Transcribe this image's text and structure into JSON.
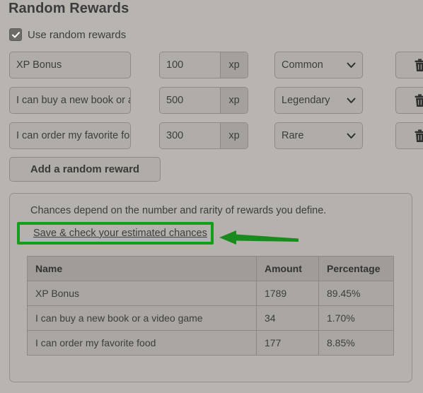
{
  "page_title": "Random Rewards",
  "use_random": {
    "label": "Use random rewards",
    "checked": true,
    "checkbox_icon": "check-icon"
  },
  "rewards": [
    {
      "name": "XP Bonus",
      "amount": "100",
      "unit": "xp",
      "rarity": "Common",
      "delete_icon": "trash-icon",
      "chevron_icon": "chevron-down-icon"
    },
    {
      "name": "I can buy a new book or a video game",
      "amount": "500",
      "unit": "xp",
      "rarity": "Legendary",
      "delete_icon": "trash-icon",
      "chevron_icon": "chevron-down-icon"
    },
    {
      "name": "I can order my favorite food",
      "amount": "300",
      "unit": "xp",
      "rarity": "Rare",
      "delete_icon": "trash-icon",
      "chevron_icon": "chevron-down-icon"
    }
  ],
  "add_button_label": "Add a random reward",
  "chances_panel": {
    "note": "Chances depend on the number and rarity of rewards you define.",
    "save_link_label": "Save & check your estimated chances",
    "table": {
      "headers": [
        "Name",
        "Amount",
        "Percentage"
      ],
      "rows": [
        {
          "name": "XP Bonus",
          "amount": "1789",
          "percentage": "89.45%"
        },
        {
          "name": "I can buy a new book or a video game",
          "amount": "34",
          "percentage": "1.70%"
        },
        {
          "name": "I can order my favorite food",
          "amount": "177",
          "percentage": "8.85%"
        }
      ]
    }
  },
  "annotation": {
    "highlight_color": "#12a01a",
    "arrow_color": "#1a8a1f",
    "arrow_direction": "left",
    "target": "Save & check your estimated chances"
  },
  "colors": {
    "background": "#b8b5b0",
    "field_background": "#b0ada8",
    "field_border": "#8d8a86",
    "addon_background": "#a4a19c",
    "panel_background": "#b5b2ad",
    "table_header": "#a09d98",
    "table_cell": "#aaa7a2",
    "text": "#3d3d3d"
  }
}
